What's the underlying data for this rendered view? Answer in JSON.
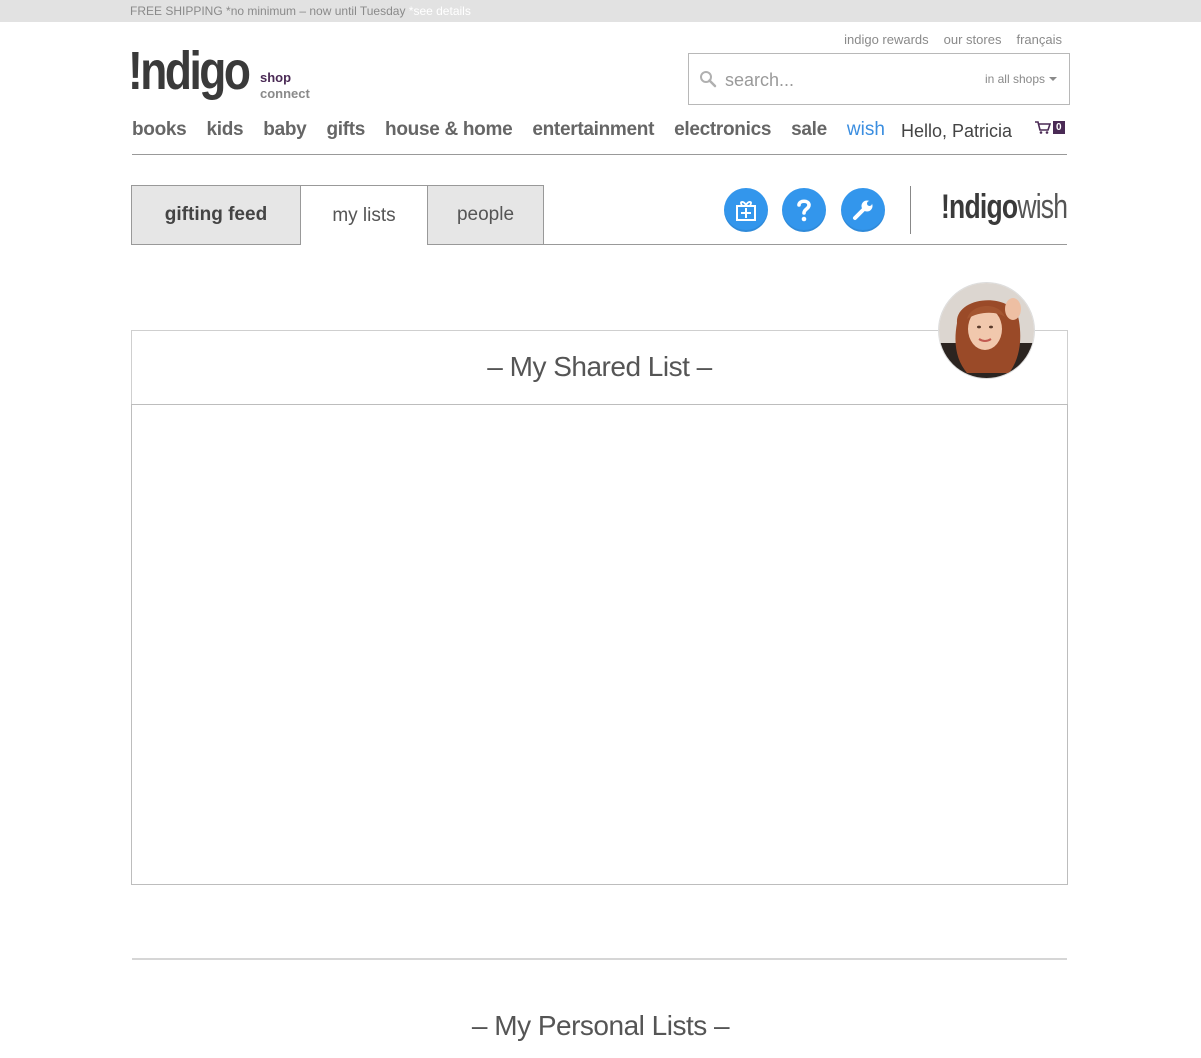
{
  "promo": {
    "text": "FREE SHIPPING *no minimum – now until Tuesday ",
    "link": "*see details"
  },
  "util_links": [
    "indigo rewards",
    "our stores",
    "français"
  ],
  "brand": {
    "logo": "!ndigo",
    "shop": "shop",
    "connect": "connect"
  },
  "search": {
    "placeholder": "search...",
    "scope": "in all shops"
  },
  "nav": {
    "items": [
      "books",
      "kids",
      "baby",
      "gifts",
      "house & home",
      "entertainment",
      "electronics",
      "sale"
    ],
    "wish": "wish",
    "greeting": "Hello, Patricia",
    "cart_count": "0"
  },
  "tabs": {
    "feed": "gifting feed",
    "lists": "my lists",
    "people": "people"
  },
  "wish_logo": {
    "brand": "!ndigo",
    "suffix": "wish"
  },
  "icons": {
    "gift": "gift-icon",
    "help": "help-icon",
    "settings": "wrench-icon",
    "search": "search-icon",
    "cart": "cart-icon",
    "accent": "#3396ec",
    "brand_purple": "#4a2a55"
  },
  "sections": {
    "shared": "– My Shared List –",
    "personal": "– My Personal Lists –"
  }
}
